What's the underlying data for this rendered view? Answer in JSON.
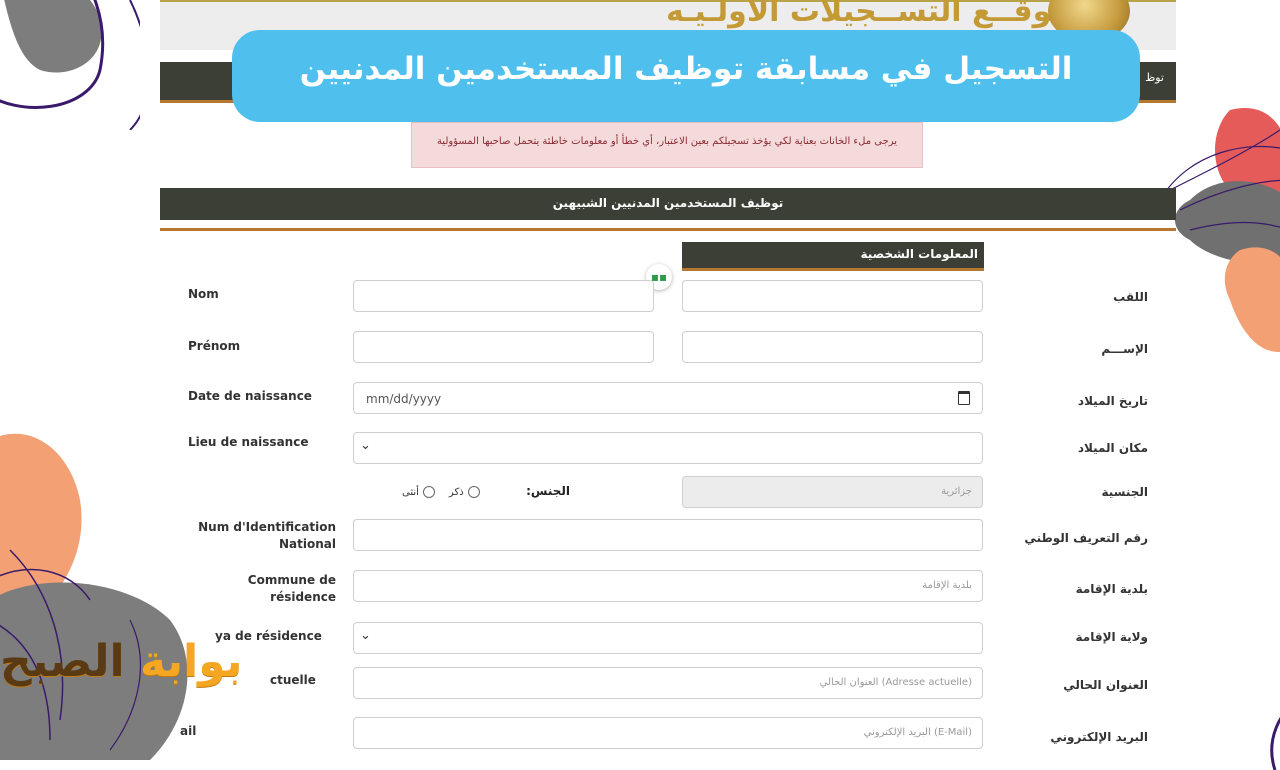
{
  "header": {
    "site_title": "موقــع التســجيلات الأولـيـه",
    "nav_text": "توظ"
  },
  "banner": {
    "title": "التسجيل في مسابقة توظيف المستخدمين المدنيين"
  },
  "notice": {
    "text": "يرجى ملء الخانات بعناية لكي يؤخذ تسجيلكم بعين الاعتبار، أي خطأ أو معلومات خاطئة يتحمل صاحبها المسؤولية"
  },
  "section": {
    "title": "توظيف المستخدمين المدنيين الشبيهين",
    "subtitle": "المعلومات الشخصية"
  },
  "form": {
    "nom": {
      "fr": "Nom",
      "ar": "اللقب"
    },
    "prenom": {
      "fr": "Prénom",
      "ar": "الإســـم"
    },
    "date": {
      "fr": "Date de naissance",
      "ar": "تاريخ الميلاد",
      "value": "mm/dd/yyyy"
    },
    "lieu": {
      "fr": "Lieu de naissance",
      "ar": "مكان الميلاد"
    },
    "nationalite": {
      "ar": "الجنسية",
      "value": "جزائرية"
    },
    "gender": {
      "label": "الجنس:",
      "male": "ذكر",
      "female": "أنثى"
    },
    "nin": {
      "fr_line1": "Num d'Identification",
      "fr_line2": "National",
      "ar": "رقم التعريف الوطني"
    },
    "commune": {
      "fr_line1": "Commune de",
      "fr_line2": "résidence",
      "ar": "بلدية الإقامة",
      "placeholder": "بلدية الإقامة"
    },
    "wilaya": {
      "fr": "ya de résidence",
      "ar": "ولاية الإقامة"
    },
    "adresse": {
      "fr": "ctuelle",
      "ar": "العنوان الحالي",
      "placeholder": "العنوان الحالي (Adresse actuelle)"
    },
    "email": {
      "fr": "ail",
      "ar": "البريد الإلكتروني",
      "placeholder": "البريد الإلكتروني (E-Mail)"
    }
  },
  "logo": {
    "part1": "بوابة",
    "part2": "الصبح"
  },
  "colors": {
    "banner": "#4fc0ee",
    "dark_bar": "#3b3f35",
    "accent": "#b5782e",
    "notice_bg": "#f5dadb",
    "logo": "#f5a623"
  }
}
